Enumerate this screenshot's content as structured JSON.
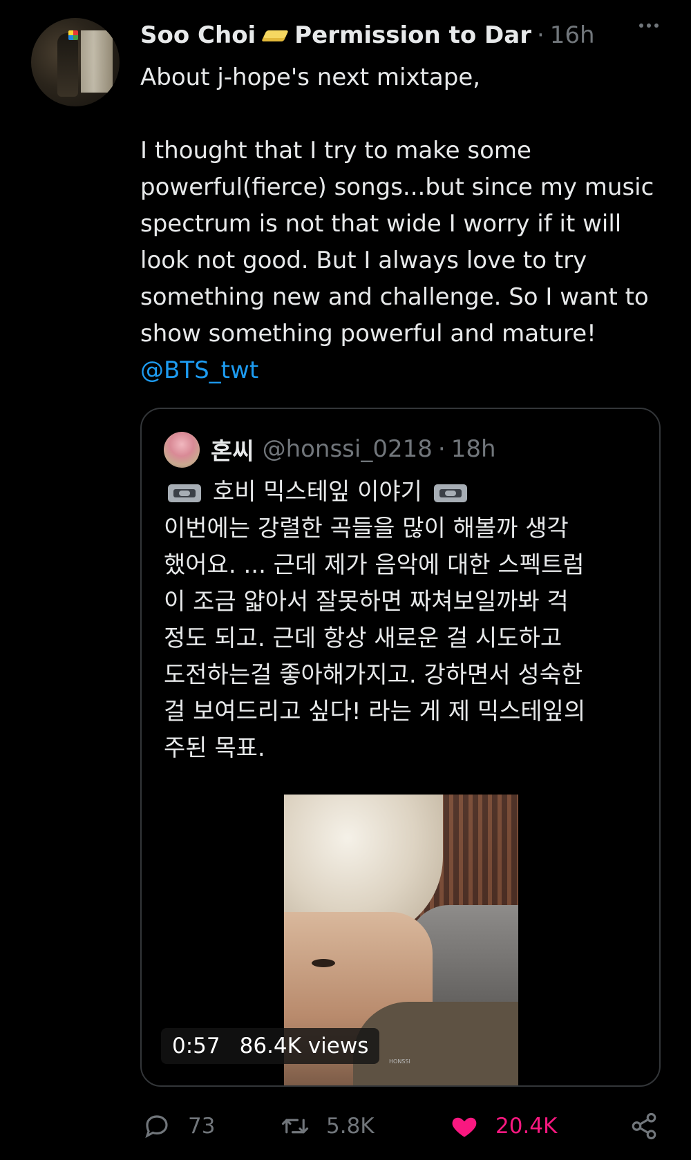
{
  "tweet": {
    "display_name": "Soo Choi",
    "name_emoji": "butter-icon",
    "name_suffix": "Permission to Dar",
    "separator": "·",
    "time": "16h",
    "more_icon": "more-horizontal-icon",
    "lines": [
      "About j-hope's next mixtape,",
      "",
      "I thought that I try to make some",
      "powerful(fierce) songs...but since my music",
      "spectrum is not that wide I worry if it will",
      "look not good. But I always love to try",
      "something new and challenge. So I want to",
      "show something powerful and mature!"
    ],
    "mention": "@BTS_twt"
  },
  "quoted_tweet": {
    "name": "혼씨",
    "handle": "@honssi_0218",
    "separator": "·",
    "time": "18h",
    "title": "호비 믹스테잎 이야기",
    "title_icon": "vhs-cassette-icon",
    "lines": [
      "이번에는 강렬한 곡들을 많이 해볼까 생각",
      "했어요. ... 근데 제가 음악에 대한 스펙트럼",
      "이 조금 얇아서 잘못하면 짜쳐보일까봐 걱",
      "정도 되고. 근데 항상 새로운 걸 시도하고",
      "도전하는걸 좋아해가지고. 강하면서 성숙한",
      "걸 보여드리고 싶다! 라는 게 제 믹스테잎의",
      "주된 목표."
    ],
    "video": {
      "duration": "0:57",
      "views": "86.4K views",
      "watermark": "HONSSI"
    }
  },
  "actions": {
    "reply": {
      "icon": "reply-icon",
      "count": "73"
    },
    "retweet": {
      "icon": "retweet-icon",
      "count": "5.8K"
    },
    "like": {
      "icon": "heart-icon",
      "count": "20.4K",
      "liked": true,
      "color": "#f91880"
    },
    "share": {
      "icon": "share-icon"
    }
  },
  "colors": {
    "background": "#000000",
    "text": "#e7e9ea",
    "secondary": "#71767b",
    "link": "#1d9bf0",
    "like": "#f91880"
  }
}
